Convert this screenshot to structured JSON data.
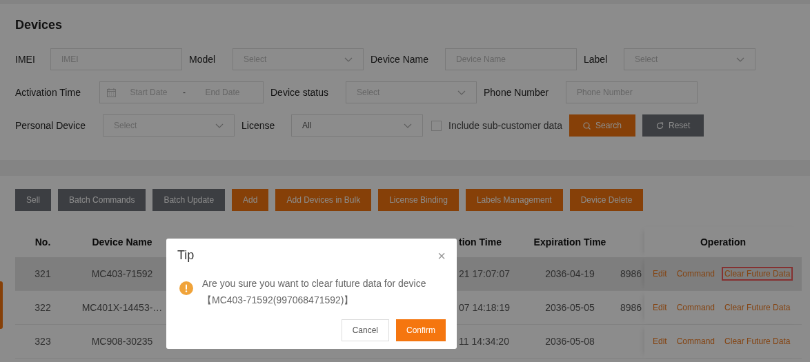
{
  "page": {
    "title": "Devices"
  },
  "filters": [
    {
      "label": "IMEI",
      "kind": "input",
      "placeholder": "IMEI"
    },
    {
      "label": "Model",
      "kind": "select",
      "placeholder": "Select"
    },
    {
      "label": "Device Name",
      "kind": "input",
      "placeholder": "Device Name"
    },
    {
      "label": "Label",
      "kind": "select",
      "placeholder": "Select"
    },
    {
      "label": "Activation Time",
      "kind": "daterange",
      "start_placeholder": "Start Date",
      "separator": "-",
      "end_placeholder": "End Date"
    },
    {
      "label": "Device status",
      "kind": "select",
      "placeholder": "Select"
    },
    {
      "label": "Phone Number",
      "kind": "input",
      "placeholder": "Phone Number"
    },
    {
      "label": "Personal Device",
      "kind": "select",
      "placeholder": "Select"
    },
    {
      "label": "License",
      "kind": "select",
      "value": "All"
    }
  ],
  "include_sub_customer": {
    "label": "Include sub-customer data",
    "checked": false
  },
  "search_button": "Search",
  "reset_button": "Reset",
  "toolbar": [
    {
      "label": "Sell",
      "kind": "secondary"
    },
    {
      "label": "Batch Commands",
      "kind": "secondary"
    },
    {
      "label": "Batch Update",
      "kind": "secondary"
    },
    {
      "label": "Add",
      "kind": "primary"
    },
    {
      "label": "Add Devices in Bulk",
      "kind": "primary"
    },
    {
      "label": "License Binding",
      "kind": "primary"
    },
    {
      "label": "Labels Management",
      "kind": "primary"
    },
    {
      "label": "Device Delete",
      "kind": "primary"
    }
  ],
  "table": {
    "columns": [
      "No.",
      "Device Name",
      "tion Time",
      "Expiration Time",
      "",
      "Operation"
    ],
    "rows": [
      {
        "selected": true,
        "cells": [
          "321",
          "MC403-71592",
          "21 17:07:07",
          "2036-04-19",
          "8986"
        ],
        "operations": [
          {
            "label": "Edit",
            "highlighted": false
          },
          {
            "label": "Command",
            "highlighted": false
          },
          {
            "label": "Clear Future Data",
            "highlighted": true
          }
        ]
      },
      {
        "selected": false,
        "cells": [
          "322",
          "MC401X-14453-…",
          "07 14:18:19",
          "2036-05-05",
          "8986"
        ],
        "operations": [
          {
            "label": "Edit",
            "highlighted": false
          },
          {
            "label": "Command",
            "highlighted": false
          },
          {
            "label": "Clear Future Data",
            "highlighted": false
          }
        ]
      },
      {
        "selected": false,
        "cells": [
          "323",
          "MC908-30235",
          "11 14:34:20",
          "2036-05-08",
          ""
        ],
        "operations": [
          {
            "label": "Edit",
            "highlighted": false
          },
          {
            "label": "Command",
            "highlighted": false
          },
          {
            "label": "Clear Future Data",
            "highlighted": false
          }
        ]
      }
    ]
  },
  "dialog": {
    "title": "Tip",
    "close": "×",
    "message": "Are you sure you want to clear future data for device【MC403-71592(997068471592)】",
    "cancel": "Cancel",
    "confirm": "Confirm"
  }
}
